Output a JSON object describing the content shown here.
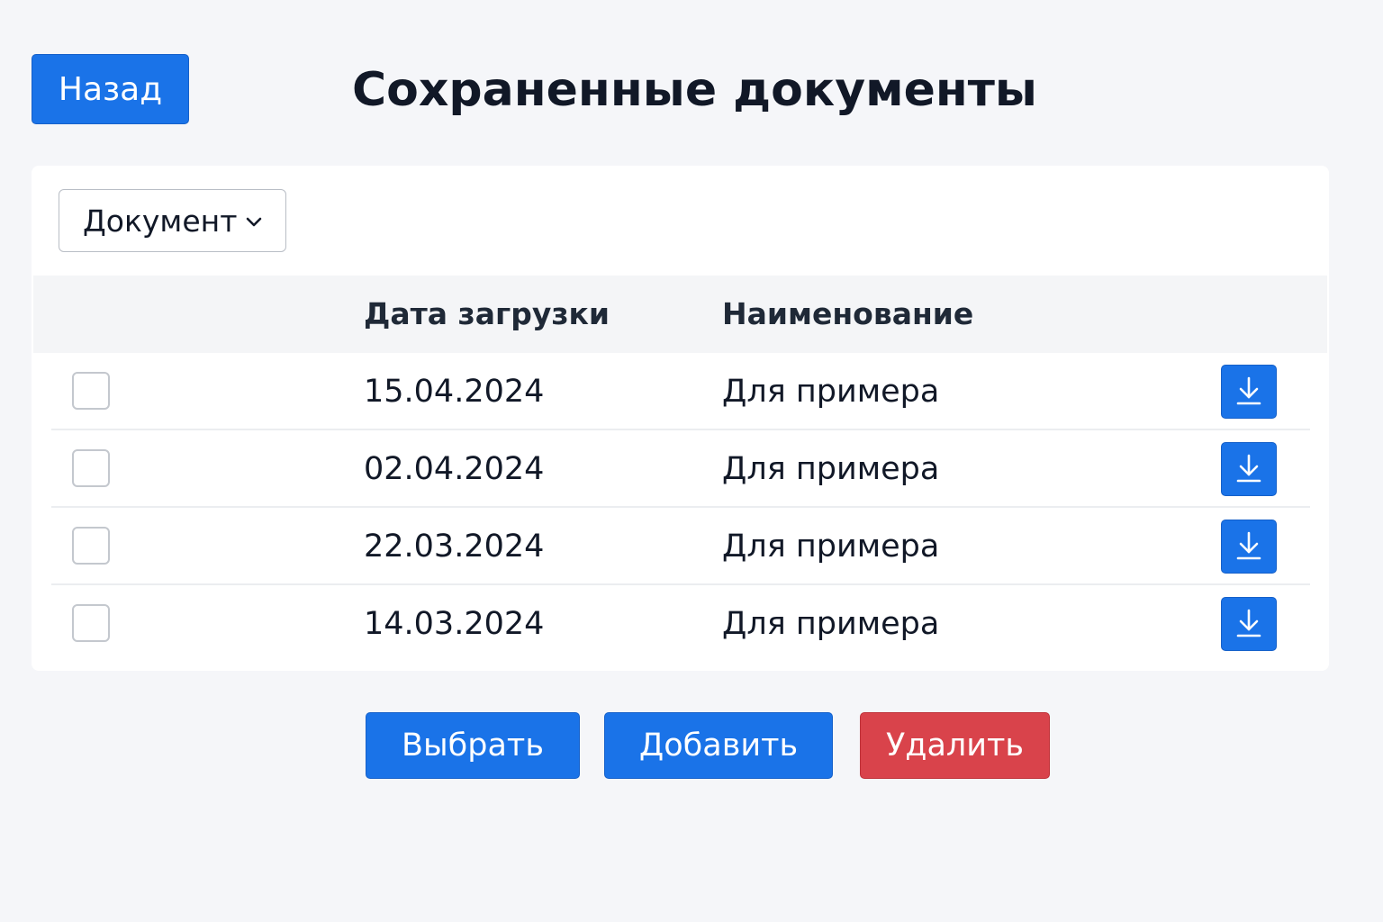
{
  "header": {
    "back_label": "Назад",
    "title": "Сохраненные документы"
  },
  "filter": {
    "selected": "Документ",
    "icon": "chevron-down-icon"
  },
  "table": {
    "columns": [
      "",
      "Дата загрузки",
      "Наименование",
      ""
    ],
    "rows": [
      {
        "checked": false,
        "date": "15.04.2024",
        "name": "Для примера"
      },
      {
        "checked": false,
        "date": "02.04.2024",
        "name": "Для примера"
      },
      {
        "checked": false,
        "date": "22.03.2024",
        "name": "Для примера"
      },
      {
        "checked": false,
        "date": "14.03.2024",
        "name": "Для примера"
      }
    ],
    "row_action_icon": "download-icon"
  },
  "actions": {
    "select_label": "Выбрать",
    "add_label": "Добавить",
    "delete_label": "Удалить"
  },
  "colors": {
    "primary": "#1a73e8",
    "danger": "#d9434b",
    "background": "#f5f6f9",
    "card": "#ffffff",
    "header_row": "#f4f5f7"
  }
}
